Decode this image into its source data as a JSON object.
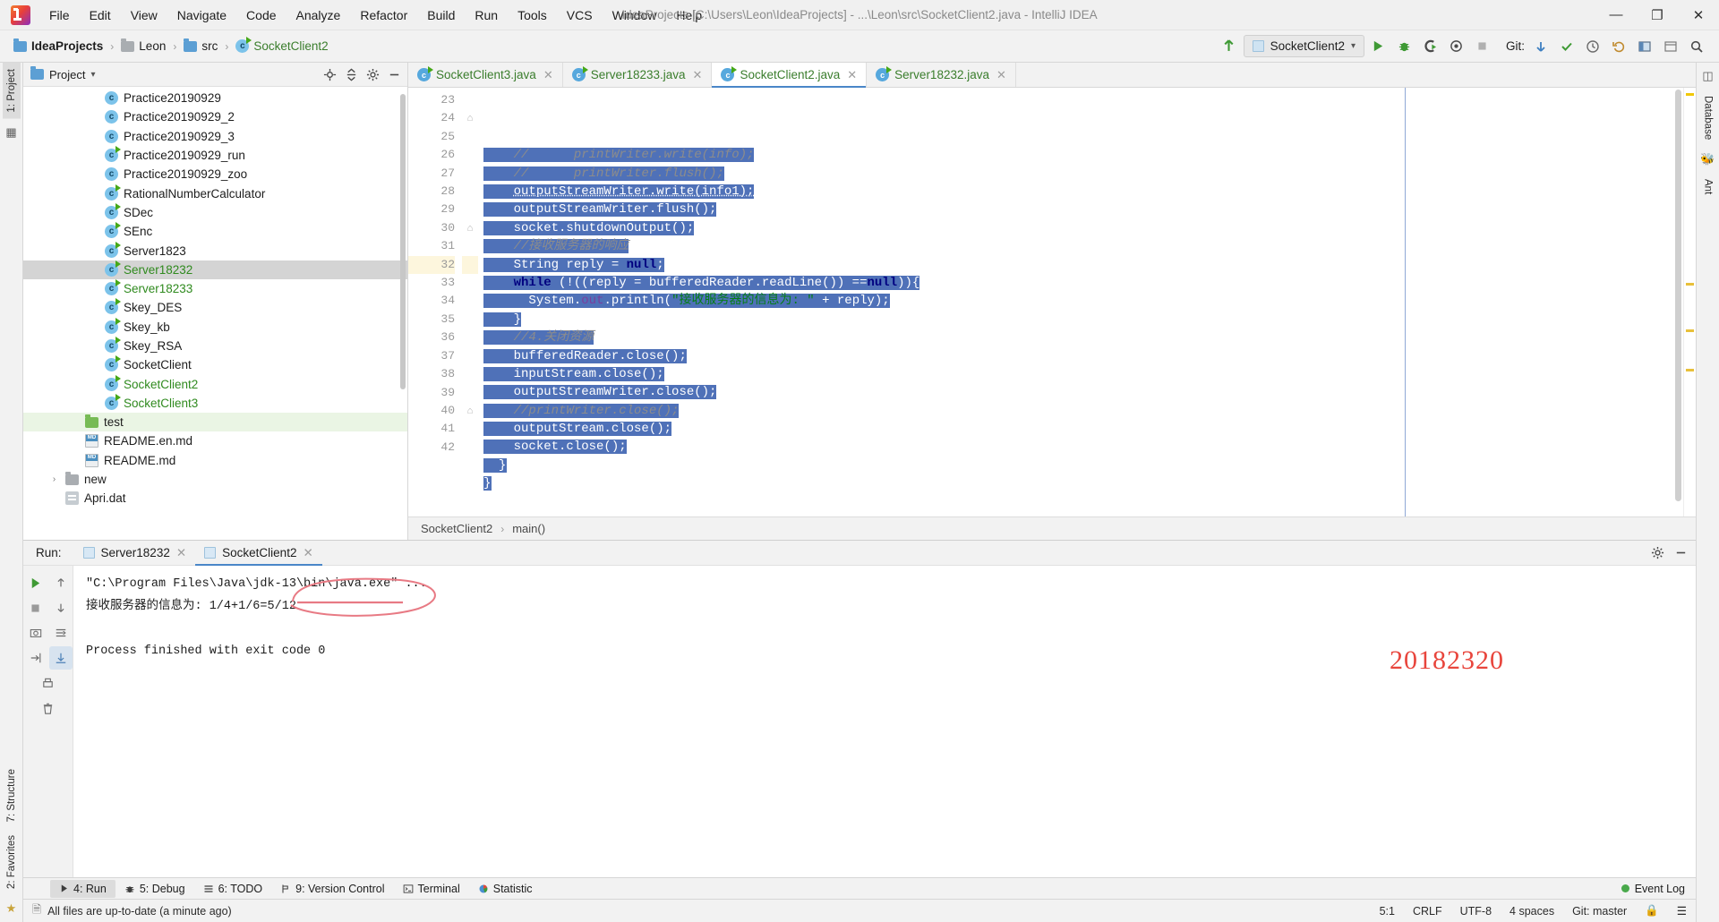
{
  "window": {
    "title": "IdeaProjects [C:\\Users\\Leon\\IdeaProjects] - ...\\Leon\\src\\SocketClient2.java - IntelliJ IDEA",
    "minimize": "—",
    "maximize": "❐",
    "close": "✕"
  },
  "menu": [
    "File",
    "Edit",
    "View",
    "Navigate",
    "Code",
    "Analyze",
    "Refactor",
    "Build",
    "Run",
    "Tools",
    "VCS",
    "Window",
    "Help"
  ],
  "breadcrumbs": [
    {
      "label": "IdeaProjects",
      "icon": "folder-icon"
    },
    {
      "label": "Leon",
      "icon": "folder-icon"
    },
    {
      "label": "src",
      "icon": "source-folder-icon"
    },
    {
      "label": "SocketClient2",
      "icon": "java-class-icon"
    }
  ],
  "toolbar": {
    "run_config": "SocketClient2",
    "git_label": "Git:",
    "icons": [
      "build-icon",
      "run-icon",
      "debug-icon",
      "run-with-coverage-icon",
      "profile-icon",
      "stop-icon",
      "git-update-icon",
      "git-commit-icon",
      "git-history-icon",
      "undo-icon",
      "ide-settings-icon",
      "layout-icon",
      "search-icon"
    ]
  },
  "left_rail": [
    {
      "label": "1: Project",
      "selected": true
    }
  ],
  "right_rail": [
    {
      "label": "Database"
    },
    {
      "label": "Ant"
    }
  ],
  "bottom_left_rail": [
    {
      "label": "7: Structure"
    },
    {
      "label": "2: Favorites"
    }
  ],
  "project_pane": {
    "title": "Project",
    "actions": [
      "locate-icon",
      "collapse-all-icon",
      "settings-icon",
      "hide-icon"
    ],
    "tree": [
      {
        "label": "Practice20190929",
        "icon": "java-class-icon",
        "indent": 3,
        "state": "normal"
      },
      {
        "label": "Practice20190929_2",
        "icon": "java-class-icon",
        "indent": 3,
        "state": "normal"
      },
      {
        "label": "Practice20190929_3",
        "icon": "java-class-icon",
        "indent": 3,
        "state": "normal"
      },
      {
        "label": "Practice20190929_run",
        "icon": "java-class-runnable-icon",
        "indent": 3,
        "state": "normal"
      },
      {
        "label": "Practice20190929_zoo",
        "icon": "java-class-icon",
        "indent": 3,
        "state": "normal"
      },
      {
        "label": "RationalNumberCalculator",
        "icon": "java-class-runnable-icon",
        "indent": 3,
        "state": "normal"
      },
      {
        "label": "SDec",
        "icon": "java-class-runnable-icon",
        "indent": 3,
        "state": "normal"
      },
      {
        "label": "SEnc",
        "icon": "java-class-runnable-icon",
        "indent": 3,
        "state": "normal"
      },
      {
        "label": "Server1823",
        "icon": "java-class-runnable-icon",
        "indent": 3,
        "state": "normal"
      },
      {
        "label": "Server18232",
        "icon": "java-class-runnable-icon",
        "indent": 3,
        "state": "selected"
      },
      {
        "label": "Server18233",
        "icon": "java-class-runnable-icon",
        "indent": 3,
        "state": "open"
      },
      {
        "label": "Skey_DES",
        "icon": "java-class-runnable-icon",
        "indent": 3,
        "state": "normal"
      },
      {
        "label": "Skey_kb",
        "icon": "java-class-runnable-icon",
        "indent": 3,
        "state": "normal"
      },
      {
        "label": "Skey_RSA",
        "icon": "java-class-runnable-icon",
        "indent": 3,
        "state": "normal"
      },
      {
        "label": "SocketClient",
        "icon": "java-class-runnable-icon",
        "indent": 3,
        "state": "normal"
      },
      {
        "label": "SocketClient2",
        "icon": "java-class-runnable-icon",
        "indent": 3,
        "state": "open"
      },
      {
        "label": "SocketClient3",
        "icon": "java-class-runnable-icon",
        "indent": 3,
        "state": "open"
      },
      {
        "label": "test",
        "icon": "source-folder-icon",
        "indent": 2,
        "state": "highlighted"
      },
      {
        "label": "README.en.md",
        "icon": "markdown-icon",
        "indent": 2,
        "state": "normal"
      },
      {
        "label": "README.md",
        "icon": "markdown-icon",
        "indent": 2,
        "state": "normal"
      },
      {
        "label": "new",
        "icon": "folder-icon",
        "indent": 1,
        "state": "normal",
        "twirl": "›"
      },
      {
        "label": "Apri.dat",
        "icon": "data-file-icon",
        "indent": 1,
        "state": "normal"
      }
    ]
  },
  "editor": {
    "tabs": [
      {
        "label": "SocketClient3.java",
        "active": false
      },
      {
        "label": "Server18233.java",
        "active": false
      },
      {
        "label": "SocketClient2.java",
        "active": true
      },
      {
        "label": "Server18232.java",
        "active": false
      }
    ],
    "first_line_number": 23,
    "lines": [
      {
        "n": 23,
        "selected": true,
        "tokens": [
          {
            "t": "//      printWriter.write(info);",
            "c": "cmt"
          }
        ],
        "indent": 4
      },
      {
        "n": 24,
        "selected": true,
        "fold": true,
        "tokens": [
          {
            "t": "//      printWriter.flush();",
            "c": "cmt"
          }
        ],
        "indent": 4
      },
      {
        "n": 25,
        "selected": true,
        "tokens": [
          {
            "t": "outputStreamWriter.write(info1);",
            "c": "underl"
          }
        ],
        "indent": 4
      },
      {
        "n": 26,
        "selected": true,
        "tokens": [
          {
            "t": "outputStreamWriter.flush();",
            "c": ""
          }
        ],
        "indent": 4
      },
      {
        "n": 27,
        "selected": true,
        "tokens": [
          {
            "t": "socket.shutdownOutput();",
            "c": ""
          }
        ],
        "indent": 4
      },
      {
        "n": 28,
        "selected": true,
        "tokens": [
          {
            "t": "//接收服务器的响应",
            "c": "cmt"
          }
        ],
        "indent": 4
      },
      {
        "n": 29,
        "selected": true,
        "tokens": [
          {
            "t": "String reply = ",
            "c": ""
          },
          {
            "t": "null",
            "c": "kw"
          },
          {
            "t": ";",
            "c": ""
          }
        ],
        "indent": 4
      },
      {
        "n": 30,
        "selected": true,
        "fold": true,
        "tokens": [
          {
            "t": "while",
            "c": "kw"
          },
          {
            "t": " (!((reply = bufferedReader.readLine()) ==",
            "c": ""
          },
          {
            "t": "null",
            "c": "kw"
          },
          {
            "t": ")){",
            "c": ""
          }
        ],
        "indent": 4
      },
      {
        "n": 31,
        "selected": true,
        "tokens": [
          {
            "t": "System.",
            "c": ""
          },
          {
            "t": "out",
            "c": "fld"
          },
          {
            "t": ".println(",
            "c": ""
          },
          {
            "t": "\"接收服务器的信息为: \"",
            "c": "str"
          },
          {
            "t": " + reply);",
            "c": ""
          }
        ],
        "indent": 6
      },
      {
        "n": 32,
        "selected": true,
        "caret": true,
        "tokens": [
          {
            "t": "}",
            "c": ""
          }
        ],
        "indent": 4
      },
      {
        "n": 33,
        "selected": true,
        "tokens": [
          {
            "t": "//4.关闭资源",
            "c": "cmt"
          }
        ],
        "indent": 4
      },
      {
        "n": 34,
        "selected": true,
        "tokens": [
          {
            "t": "bufferedReader.close();",
            "c": ""
          }
        ],
        "indent": 4
      },
      {
        "n": 35,
        "selected": true,
        "tokens": [
          {
            "t": "inputStream.close();",
            "c": ""
          }
        ],
        "indent": 4
      },
      {
        "n": 36,
        "selected": true,
        "tokens": [
          {
            "t": "outputStreamWriter.close();",
            "c": ""
          }
        ],
        "indent": 4
      },
      {
        "n": 37,
        "selected": true,
        "tokens": [
          {
            "t": "//printWriter.close();",
            "c": "cmt"
          }
        ],
        "indent": 4
      },
      {
        "n": 38,
        "selected": true,
        "tokens": [
          {
            "t": "outputStream.close();",
            "c": ""
          }
        ],
        "indent": 4
      },
      {
        "n": 39,
        "selected": true,
        "tokens": [
          {
            "t": "socket.close();",
            "c": ""
          }
        ],
        "indent": 4
      },
      {
        "n": 40,
        "selected": true,
        "fold": true,
        "tokens": [
          {
            "t": "}",
            "c": ""
          }
        ],
        "indent": 2
      },
      {
        "n": 41,
        "selected": true,
        "tokens": [
          {
            "t": "}",
            "c": ""
          }
        ],
        "indent": 0
      },
      {
        "n": 42,
        "selected": false,
        "tokens": [
          {
            "t": "",
            "c": ""
          }
        ],
        "indent": 0
      }
    ],
    "breadcrumb": [
      "SocketClient2",
      "main()"
    ]
  },
  "run_panel": {
    "label": "Run:",
    "tabs": [
      {
        "label": "Server18232",
        "active": false
      },
      {
        "label": "SocketClient2",
        "active": true
      }
    ],
    "console": [
      "\"C:\\Program Files\\Java\\jdk-13\\bin\\java.exe\" ...",
      "接收服务器的信息为: 1/4+1/6=5/12",
      "",
      "Process finished with exit code 0"
    ],
    "watermark": "20182320",
    "tool_icons": [
      "rerun-icon",
      "stop-icon",
      "trash-icon",
      "print-icon",
      "camera-icon",
      "up-icon",
      "down-icon",
      "soft-wrap-icon",
      "scroll-to-end-icon"
    ],
    "header_icons": [
      "settings-icon",
      "hide-icon"
    ]
  },
  "bottom_bar": {
    "items": [
      {
        "label": "4: Run",
        "num": "4",
        "icon": "run-icon",
        "active": true
      },
      {
        "label": "5: Debug",
        "num": "5",
        "icon": "debug-icon",
        "active": false
      },
      {
        "label": "6: TODO",
        "num": "6",
        "icon": "todo-icon",
        "active": false
      },
      {
        "label": "9: Version Control",
        "num": "9",
        "icon": "vcs-icon",
        "active": false
      },
      {
        "label": "Terminal",
        "num": "",
        "icon": "terminal-icon",
        "active": false
      },
      {
        "label": "Statistic",
        "num": "",
        "icon": "statistic-icon",
        "active": false
      }
    ],
    "event_log": "Event Log"
  },
  "status_bar": {
    "message": "All files are up-to-date (a minute ago)",
    "caret": "5:1",
    "line_sep": "CRLF",
    "encoding": "UTF-8",
    "indent": "4 spaces",
    "branch": "Git: master"
  },
  "colors": {
    "selection": "#4f71b8",
    "accent": "#4a86c8",
    "green_file": "#2f8a1e",
    "annotation_red": "#e8453c",
    "comment_gray": "#8c8c8c",
    "string_green": "#067d17",
    "keyword_blue": "#000080"
  }
}
